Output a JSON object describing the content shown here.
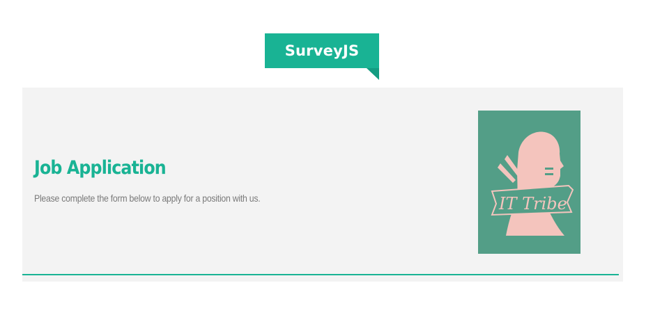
{
  "brand": {
    "logo_text": "SurveyJS",
    "accent_color": "#19b394"
  },
  "survey": {
    "title": "Job Application",
    "description": "Please complete the form below to apply for a position with us.",
    "logo": {
      "icon": "it-tribe-logo",
      "text": "IT Tribe",
      "background_color": "#539e87",
      "figure_color": "#f4c4bd"
    }
  }
}
